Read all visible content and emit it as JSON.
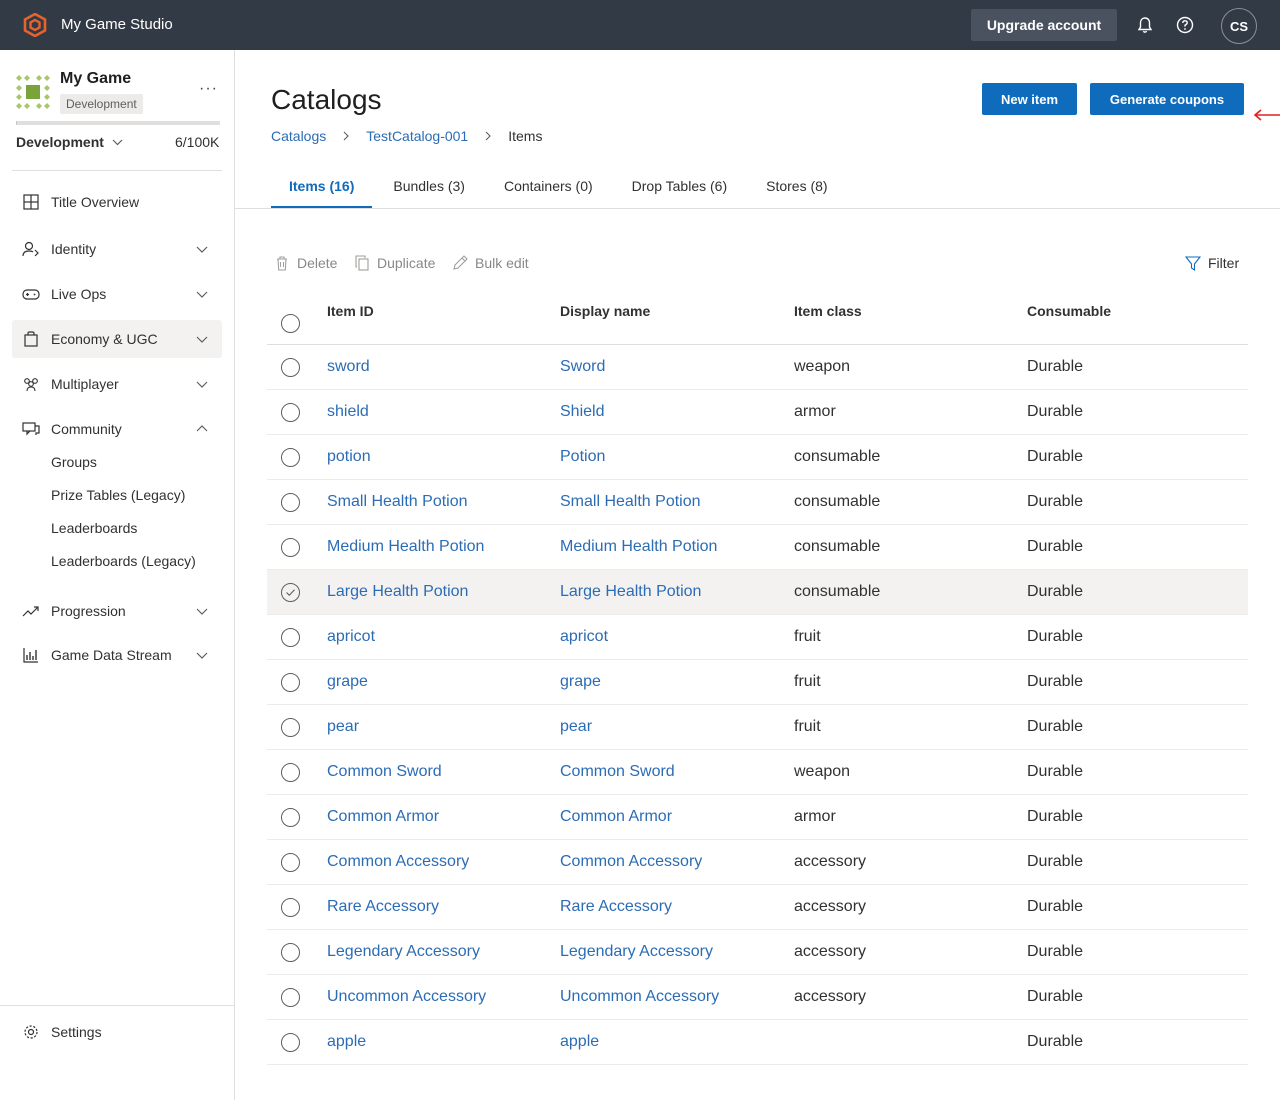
{
  "topbar": {
    "studio_name": "My Game Studio",
    "upgrade_label": "Upgrade account",
    "user_initials": "CS"
  },
  "sidebar": {
    "game_name": "My Game",
    "env_badge": "Development",
    "env_select": "Development",
    "usage": "6/100K",
    "usage_fraction": 6e-05,
    "nav": [
      {
        "label": "Title Overview",
        "icon": "grid-icon"
      },
      {
        "label": "Identity",
        "icon": "identity-icon"
      },
      {
        "label": "Live Ops",
        "icon": "gamepad-icon"
      },
      {
        "label": "Economy & UGC",
        "icon": "shopping-bag-icon"
      },
      {
        "label": "Multiplayer",
        "icon": "people-icon"
      },
      {
        "label": "Community",
        "icon": "chat-icon"
      },
      {
        "label": "Progression",
        "icon": "trend-icon"
      },
      {
        "label": "Game Data Stream",
        "icon": "chart-icon"
      }
    ],
    "community_sub": [
      "Groups",
      "Prize Tables (Legacy)",
      "Leaderboards",
      "Leaderboards (Legacy)"
    ],
    "settings_label": "Settings"
  },
  "main": {
    "title": "Catalogs",
    "new_item_label": "New item",
    "generate_coupons_label": "Generate coupons",
    "breadcrumb": [
      "Catalogs",
      "TestCatalog-001",
      "Items"
    ],
    "tabs": [
      "Items (16)",
      "Bundles (3)",
      "Containers (0)",
      "Drop Tables (6)",
      "Stores (8)"
    ],
    "toolbar": {
      "delete": "Delete",
      "duplicate": "Duplicate",
      "bulk_edit": "Bulk edit",
      "filter": "Filter"
    },
    "columns": [
      "Item ID",
      "Display name",
      "Item class",
      "Consumable"
    ],
    "rows": [
      {
        "id": "sword",
        "name": "Sword",
        "cls": "weapon",
        "cons": "Durable"
      },
      {
        "id": "shield",
        "name": "Shield",
        "cls": "armor",
        "cons": "Durable"
      },
      {
        "id": "potion",
        "name": "Potion",
        "cls": "consumable",
        "cons": "Durable"
      },
      {
        "id": "Small Health Potion",
        "name": "Small Health Potion",
        "cls": "consumable",
        "cons": "Durable"
      },
      {
        "id": "Medium Health Potion",
        "name": "Medium Health Potion",
        "cls": "consumable",
        "cons": "Durable"
      },
      {
        "id": "Large Health Potion",
        "name": "Large Health Potion",
        "cls": "consumable",
        "cons": "Durable"
      },
      {
        "id": "apricot",
        "name": "apricot",
        "cls": "fruit",
        "cons": "Durable"
      },
      {
        "id": "grape",
        "name": "grape",
        "cls": "fruit",
        "cons": "Durable"
      },
      {
        "id": "pear",
        "name": "pear",
        "cls": "fruit",
        "cons": "Durable"
      },
      {
        "id": "Common Sword",
        "name": "Common Sword",
        "cls": "weapon",
        "cons": "Durable"
      },
      {
        "id": "Common Armor",
        "name": "Common Armor",
        "cls": "armor",
        "cons": "Durable"
      },
      {
        "id": "Common Accessory",
        "name": "Common Accessory",
        "cls": "accessory",
        "cons": "Durable"
      },
      {
        "id": "Rare Accessory",
        "name": "Rare Accessory",
        "cls": "accessory",
        "cons": "Durable"
      },
      {
        "id": "Legendary Accessory",
        "name": "Legendary Accessory",
        "cls": "accessory",
        "cons": "Durable"
      },
      {
        "id": "Uncommon Accessory",
        "name": "Uncommon Accessory",
        "cls": "accessory",
        "cons": "Durable"
      },
      {
        "id": "apple",
        "name": "apple",
        "cls": "",
        "cons": "Durable"
      }
    ],
    "hovered_row_index": 5
  },
  "colors": {
    "topbar": "#323a45",
    "primary": "#0f6cbd",
    "link": "#2b6cb5",
    "annotation_arrow": "#e02020",
    "logo": "#e8632b"
  }
}
